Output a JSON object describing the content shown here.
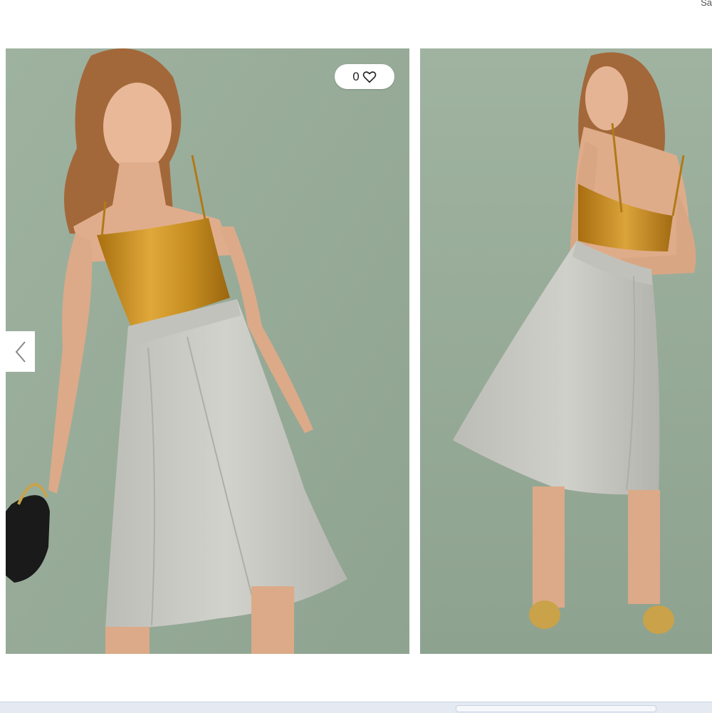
{
  "header": {
    "corner_text": "Sa"
  },
  "like_button": {
    "count": "0",
    "icon": "heart-icon"
  },
  "gallery": {
    "prev_icon": "chevron-left-icon",
    "background_color": "#9aad9b",
    "images": [
      {
        "view": "front",
        "top_color": "#c8901d",
        "skirt_color": "#c9c9c4"
      },
      {
        "view": "back",
        "top_color": "#c8901d",
        "skirt_color": "#c9c9c4"
      }
    ]
  }
}
